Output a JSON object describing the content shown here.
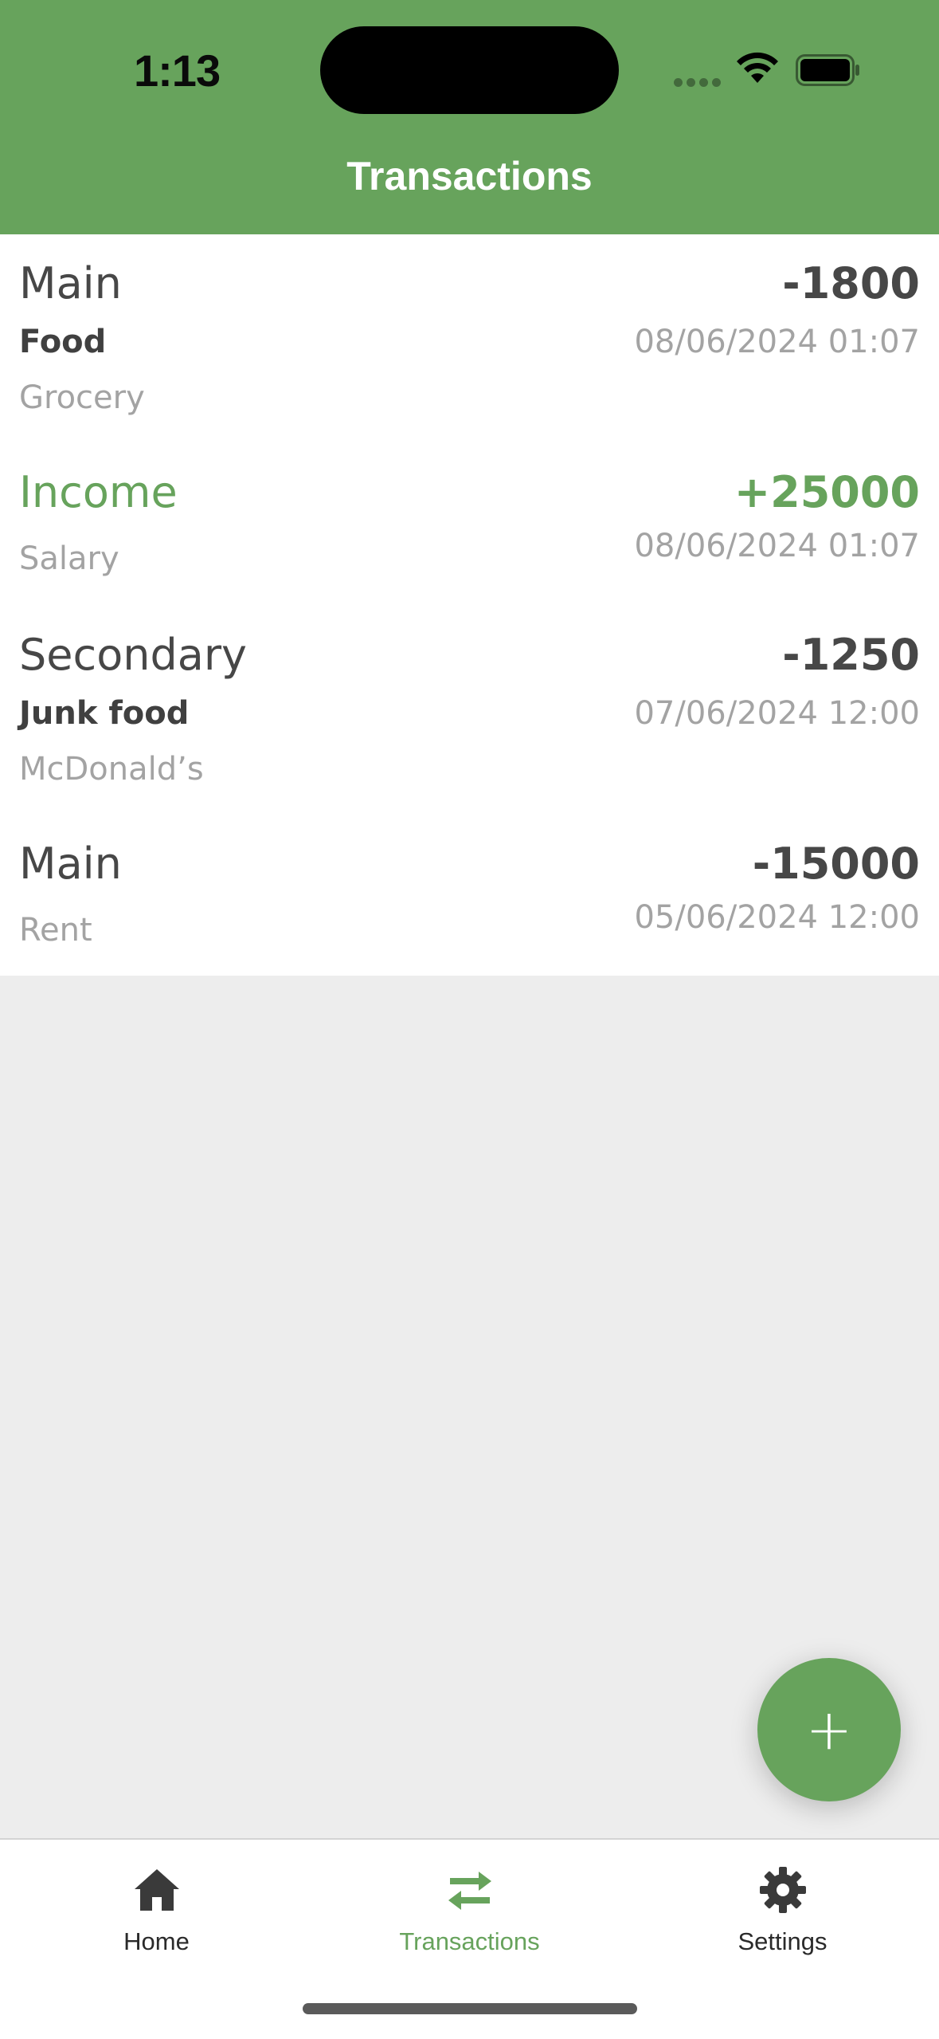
{
  "status_bar": {
    "time": "1:13"
  },
  "header": {
    "title": "Transactions"
  },
  "transactions": [
    {
      "account": "Main",
      "amount": "-1800",
      "category": "Food",
      "note": "Grocery",
      "date": "08/06/2024 01:07"
    },
    {
      "account": "Income",
      "amount": "+25000",
      "category": "",
      "note": "Salary",
      "date": "08/06/2024 01:07"
    },
    {
      "account": "Secondary",
      "amount": "-1250",
      "category": "Junk food",
      "note": "McDonald’s",
      "date": "07/06/2024 12:00"
    },
    {
      "account": "Main",
      "amount": "-15000",
      "category": "",
      "note": "Rent",
      "date": "05/06/2024 12:00"
    }
  ],
  "fab": {
    "label": "+"
  },
  "tabbar": {
    "tabs": [
      {
        "label": "Home",
        "icon": "home-icon"
      },
      {
        "label": "Transactions",
        "icon": "swap-arrows-icon",
        "active": true
      },
      {
        "label": "Settings",
        "icon": "gear-icon"
      }
    ]
  },
  "colors": {
    "accent": "#67a35c",
    "background": "#ededed",
    "text_primary": "#474747",
    "text_secondary": "#a3a3a3"
  }
}
